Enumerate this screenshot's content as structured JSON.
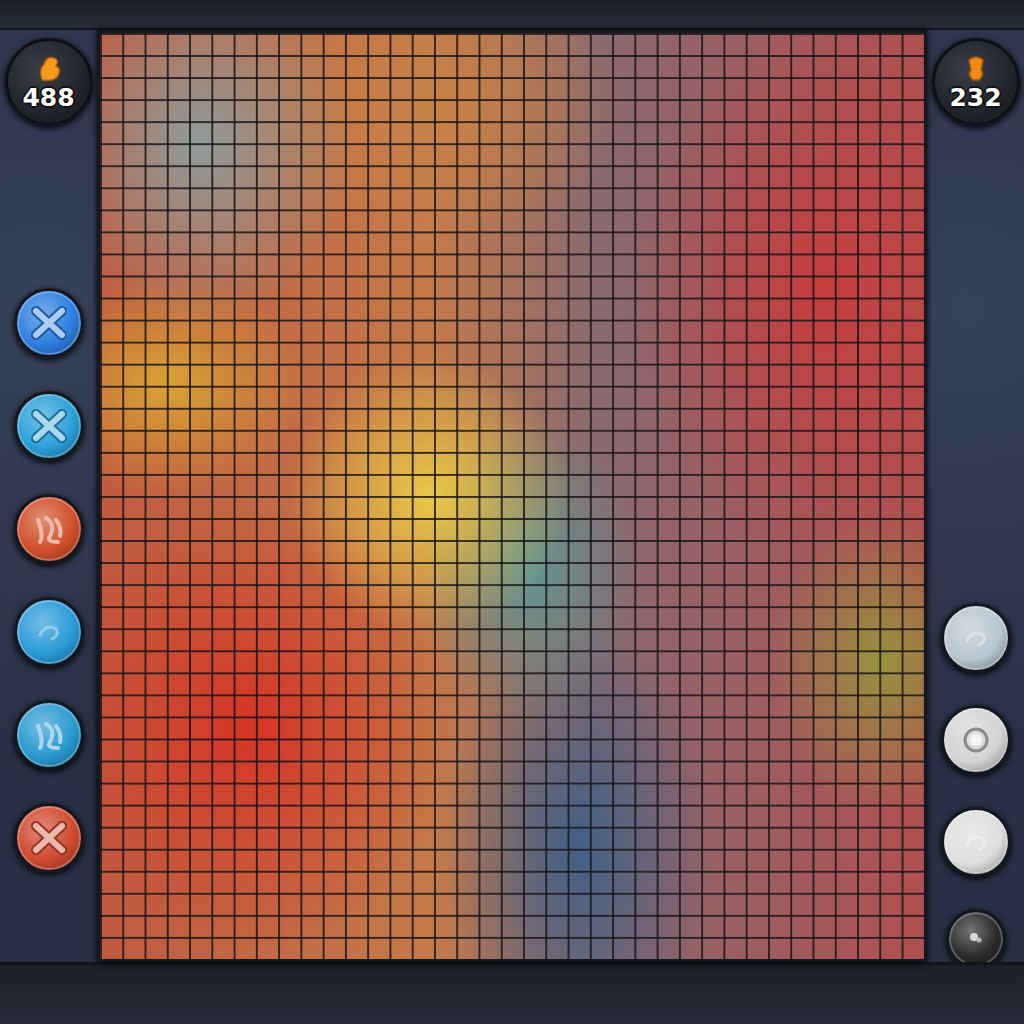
{
  "scoreboard": {
    "left": {
      "score": "488"
    },
    "right": {
      "score": "232"
    }
  },
  "left_tools": [
    {
      "kind": "cross",
      "color": "#2d7fe0"
    },
    {
      "kind": "cross",
      "color": "#2aa0d8"
    },
    {
      "kind": "glyph",
      "color": "#d0502a"
    },
    {
      "kind": "blank",
      "color": "#2a9ad8"
    },
    {
      "kind": "glyph",
      "color": "#2a9ad0"
    },
    {
      "kind": "cross",
      "color": "#d04a30"
    }
  ],
  "right_tools": [
    {
      "kind": "blank",
      "color": "#b8c6d0"
    },
    {
      "kind": "ring",
      "color": "#d4d4d4"
    },
    {
      "kind": "blank",
      "color": "#dedede"
    },
    {
      "kind": "dot",
      "color": "#2a2a2a"
    }
  ],
  "board": {
    "columns": 37,
    "rows": 42
  }
}
